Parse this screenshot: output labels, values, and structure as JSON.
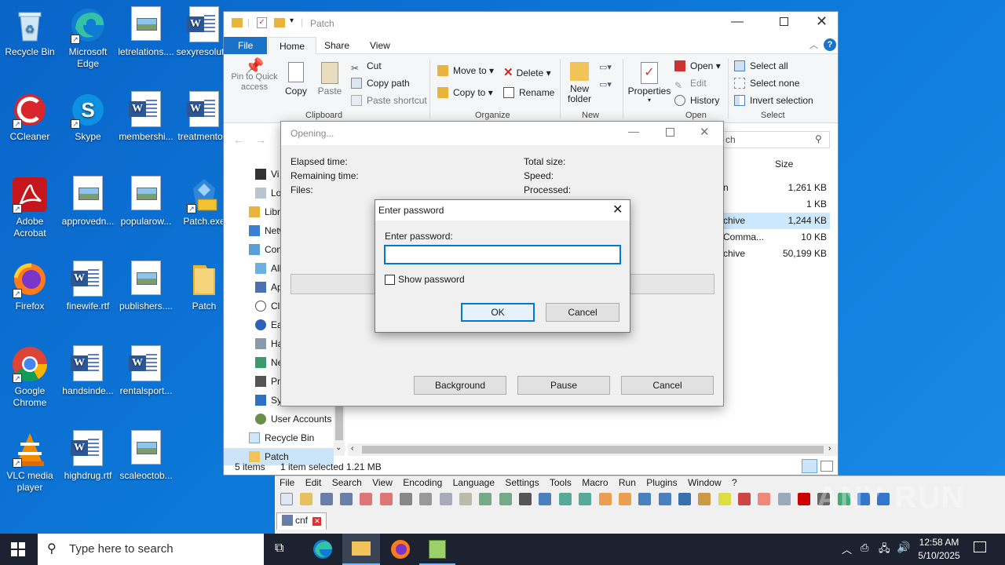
{
  "desktop": {
    "icons": [
      {
        "label": "Recycle Bin",
        "icon": "recycle-bin-icon"
      },
      {
        "label": "Microsoft Edge",
        "icon": "edge-icon"
      },
      {
        "label": "letrelations....",
        "icon": "image-file-icon"
      },
      {
        "label": "sexyresolut...",
        "icon": "word-doc-icon"
      },
      {
        "label": "CCleaner",
        "icon": "ccleaner-icon"
      },
      {
        "label": "Skype",
        "icon": "skype-icon"
      },
      {
        "label": "membershi...",
        "icon": "word-doc-icon"
      },
      {
        "label": "treatmento...",
        "icon": "word-doc-icon"
      },
      {
        "label": "Adobe Acrobat",
        "icon": "acrobat-icon"
      },
      {
        "label": "approvedn...",
        "icon": "image-file-icon"
      },
      {
        "label": "popularow...",
        "icon": "image-file-icon"
      },
      {
        "label": "Patch.exe",
        "icon": "installer-icon"
      },
      {
        "label": "Firefox",
        "icon": "firefox-icon"
      },
      {
        "label": "finewife.rtf",
        "icon": "word-doc-icon"
      },
      {
        "label": "publishers....",
        "icon": "image-file-icon"
      },
      {
        "label": "Patch",
        "icon": "folder-icon"
      },
      {
        "label": "Google Chrome",
        "icon": "chrome-icon"
      },
      {
        "label": "handsinde...",
        "icon": "word-doc-icon"
      },
      {
        "label": "rentalsport...",
        "icon": "word-doc-icon"
      },
      {
        "label": "VLC media player",
        "icon": "vlc-icon"
      },
      {
        "label": "highdrug.rtf",
        "icon": "word-doc-icon"
      },
      {
        "label": "scaleoctob...",
        "icon": "image-file-icon"
      }
    ]
  },
  "explorer": {
    "title": "Patch",
    "tabs": [
      "File",
      "Home",
      "Share",
      "View"
    ],
    "clipboard": {
      "pin": "Pin to Quick access",
      "copy": "Copy",
      "paste": "Paste",
      "cut": "Cut",
      "copy_path": "Copy path",
      "paste_shortcut": "Paste shortcut",
      "label": "Clipboard"
    },
    "organize": {
      "move_to": "Move to",
      "copy_to": "Copy to",
      "delete": "Delete",
      "rename": "Rename",
      "label": "Organize"
    },
    "new": {
      "new_folder": "New folder",
      "label": "New"
    },
    "open": {
      "properties": "Properties",
      "open": "Open",
      "edit": "Edit",
      "history": "History",
      "label": "Open"
    },
    "select": {
      "select_all": "Select all",
      "select_none": "Select none",
      "invert": "Invert selection",
      "label": "Select"
    },
    "search_placeholder": "ch",
    "column_size": "Size",
    "nav_items": [
      "Vi",
      "Lo",
      "Libr",
      "Netw",
      "Con",
      "All",
      "Ap",
      "Cl",
      "Ea",
      "Ha",
      "Ne",
      "Pr",
      "Sy",
      "User Accounts",
      "Recycle Bin",
      "Patch"
    ],
    "files": [
      {
        "type": "n",
        "size": "1,261 KB"
      },
      {
        "type": "",
        "size": "1 KB"
      },
      {
        "type": "chive",
        "size": "1,244 KB"
      },
      {
        "type": "Comma...",
        "size": "10 KB"
      },
      {
        "type": "chive",
        "size": "50,199 KB"
      }
    ],
    "status": {
      "count": "5 items",
      "selected": "1 item selected  1.21 MB"
    }
  },
  "opening": {
    "title": "Opening...",
    "elapsed": "Elapsed time:",
    "remaining": "Remaining time:",
    "files": "Files:",
    "total_size": "Total size:",
    "speed": "Speed:",
    "processed": "Processed:",
    "background": "Background",
    "pause": "Pause",
    "cancel": "Cancel"
  },
  "password_dialog": {
    "title": "Enter password",
    "prompt": "Enter password:",
    "value": "",
    "show_password": "Show password",
    "ok": "OK",
    "cancel": "Cancel"
  },
  "notepadpp": {
    "menu": [
      "File",
      "Edit",
      "Search",
      "View",
      "Encoding",
      "Language",
      "Settings",
      "Tools",
      "Macro",
      "Run",
      "Plugins",
      "Window",
      "?"
    ],
    "tab": "cnf"
  },
  "taskbar": {
    "search_placeholder": "Type here to search",
    "time": "12:58 AM",
    "date": "5/10/2025"
  },
  "watermark": "ANY RUN"
}
